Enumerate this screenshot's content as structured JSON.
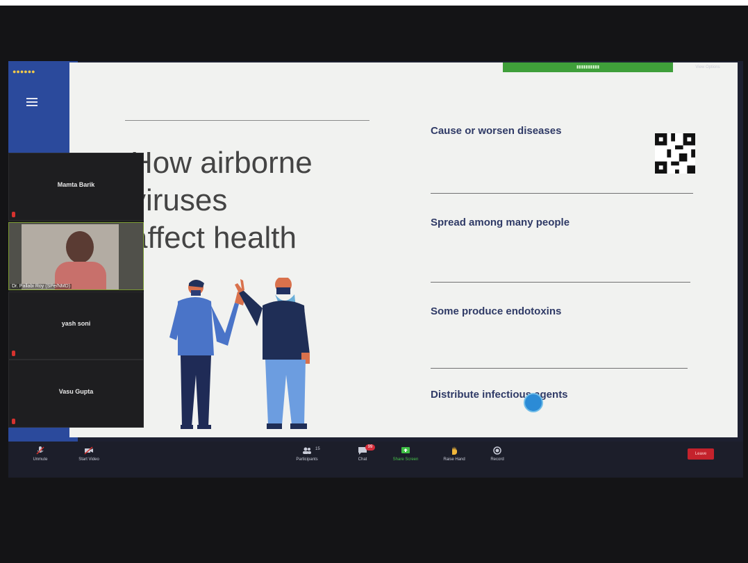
{
  "gallery": {
    "participants": [
      {
        "name": "Mamta Barik",
        "video": false
      },
      {
        "name": "Dr. Pallabi Roy (SPe/NMD)",
        "video": true
      },
      {
        "name": "yash soni",
        "video": false
      },
      {
        "name": "Vasu Gupta",
        "video": false
      }
    ]
  },
  "slide": {
    "title_lines": [
      "How airborne",
      "viruses",
      "affect health"
    ],
    "items": [
      "Cause or worsen diseases",
      "Spread among many people",
      "Some produce endotoxins",
      "Distribute infectious agents"
    ]
  },
  "toolbar": {
    "unmute": "Unmute",
    "start_video": "Start Video",
    "participants": "Participants",
    "participants_count": "15",
    "chat": "Chat",
    "chat_badge": "99",
    "share_screen": "Share Screen",
    "raise_hand": "Raise Hand",
    "record": "Record",
    "end": "Leave"
  },
  "header": {
    "view_options": "View Options"
  },
  "colors": {
    "slide_bg": "#f1f2f0",
    "accent_blue": "#2b4a9c",
    "share_green": "#3f9f3a",
    "end_red": "#c4222c"
  }
}
